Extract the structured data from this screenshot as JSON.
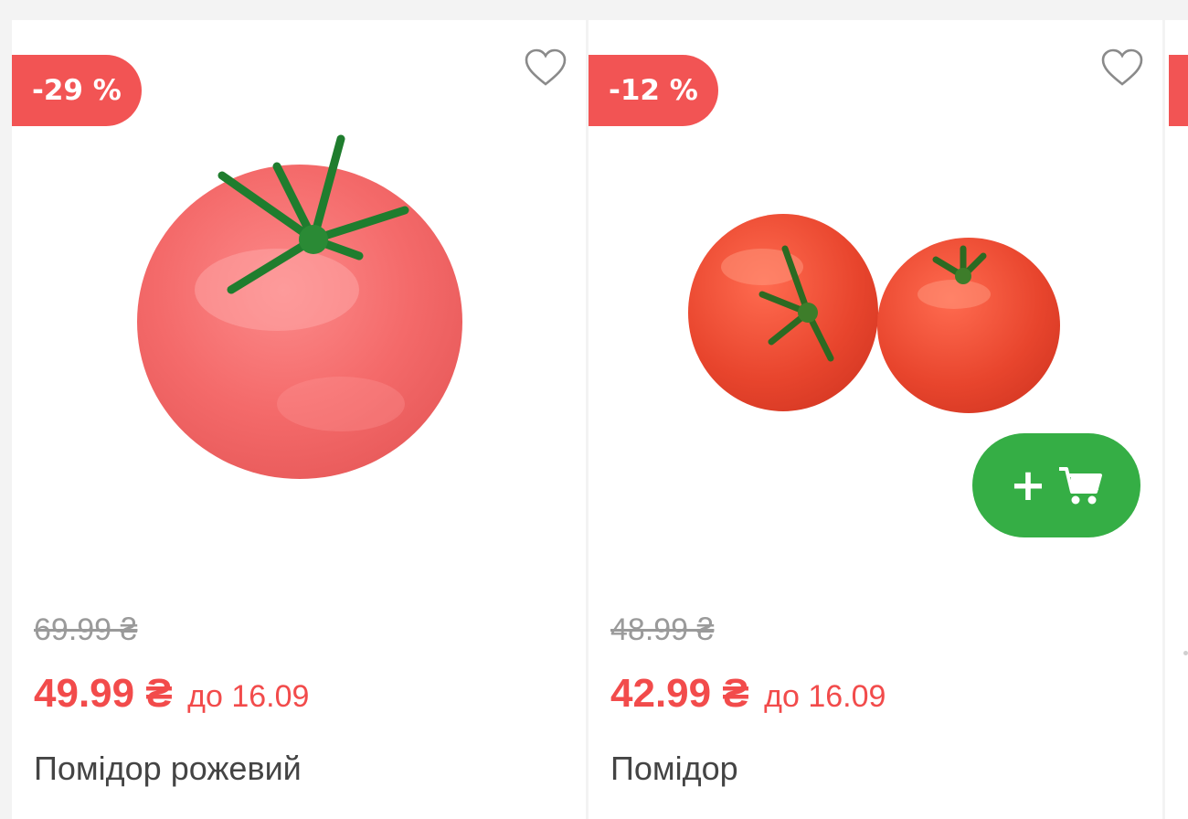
{
  "products": [
    {
      "discount": "-29 %",
      "old_price": "69.99 ₴",
      "new_price": "49.99 ₴",
      "promo_until": "до 16.09",
      "name": "Помідор рожевий",
      "image": "pink-tomato",
      "favorite_icon": "heart-icon"
    },
    {
      "discount": "-12 %",
      "old_price": "48.99 ₴",
      "new_price": "42.99 ₴",
      "promo_until": "до 16.09",
      "name": "Помідор",
      "image": "two-tomatoes",
      "favorite_icon": "heart-icon",
      "add_to_cart_plus": "+",
      "add_to_cart_icon": "cart-icon"
    }
  ],
  "colors": {
    "badge": "#f25454",
    "price": "#f24b4b",
    "cart_button": "#35ae45",
    "old_price": "#9a9a9a",
    "name": "#444444"
  }
}
